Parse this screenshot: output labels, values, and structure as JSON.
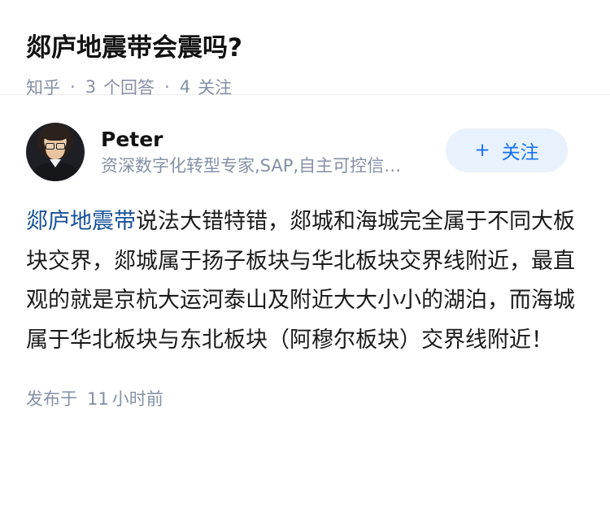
{
  "question": {
    "title": "郯庐地震带会震吗?",
    "source": "知乎",
    "separator": "·",
    "answers_count": "3",
    "answers_label": "个回答",
    "followers_count": "4",
    "followers_label": "关注"
  },
  "answer": {
    "author": {
      "name": "Peter",
      "bio": "资深数字化转型专家,SAP,自主可控信息化系统规划"
    },
    "follow_button": {
      "icon": "plus-icon",
      "icon_glyph": "+",
      "label": "关注"
    },
    "keyword_link": "郯庐地震带",
    "content": "说法大错特错，郯城和海城完全属于不同大板块交界，郯城属于扬子板块与华北板块交界线附近，最直观的就是京杭大运河泰山及附近大大小小的湖泊，而海城属于华北板块与东北板块（阿穆尔板块）交界线附近！",
    "publish": {
      "prefix": "发布于",
      "value": "11",
      "suffix": "小时前"
    }
  },
  "colors": {
    "link": "#175199",
    "muted": "#8590a6",
    "follow_bg": "#e8f2fc",
    "follow_text": "#1772f6"
  }
}
